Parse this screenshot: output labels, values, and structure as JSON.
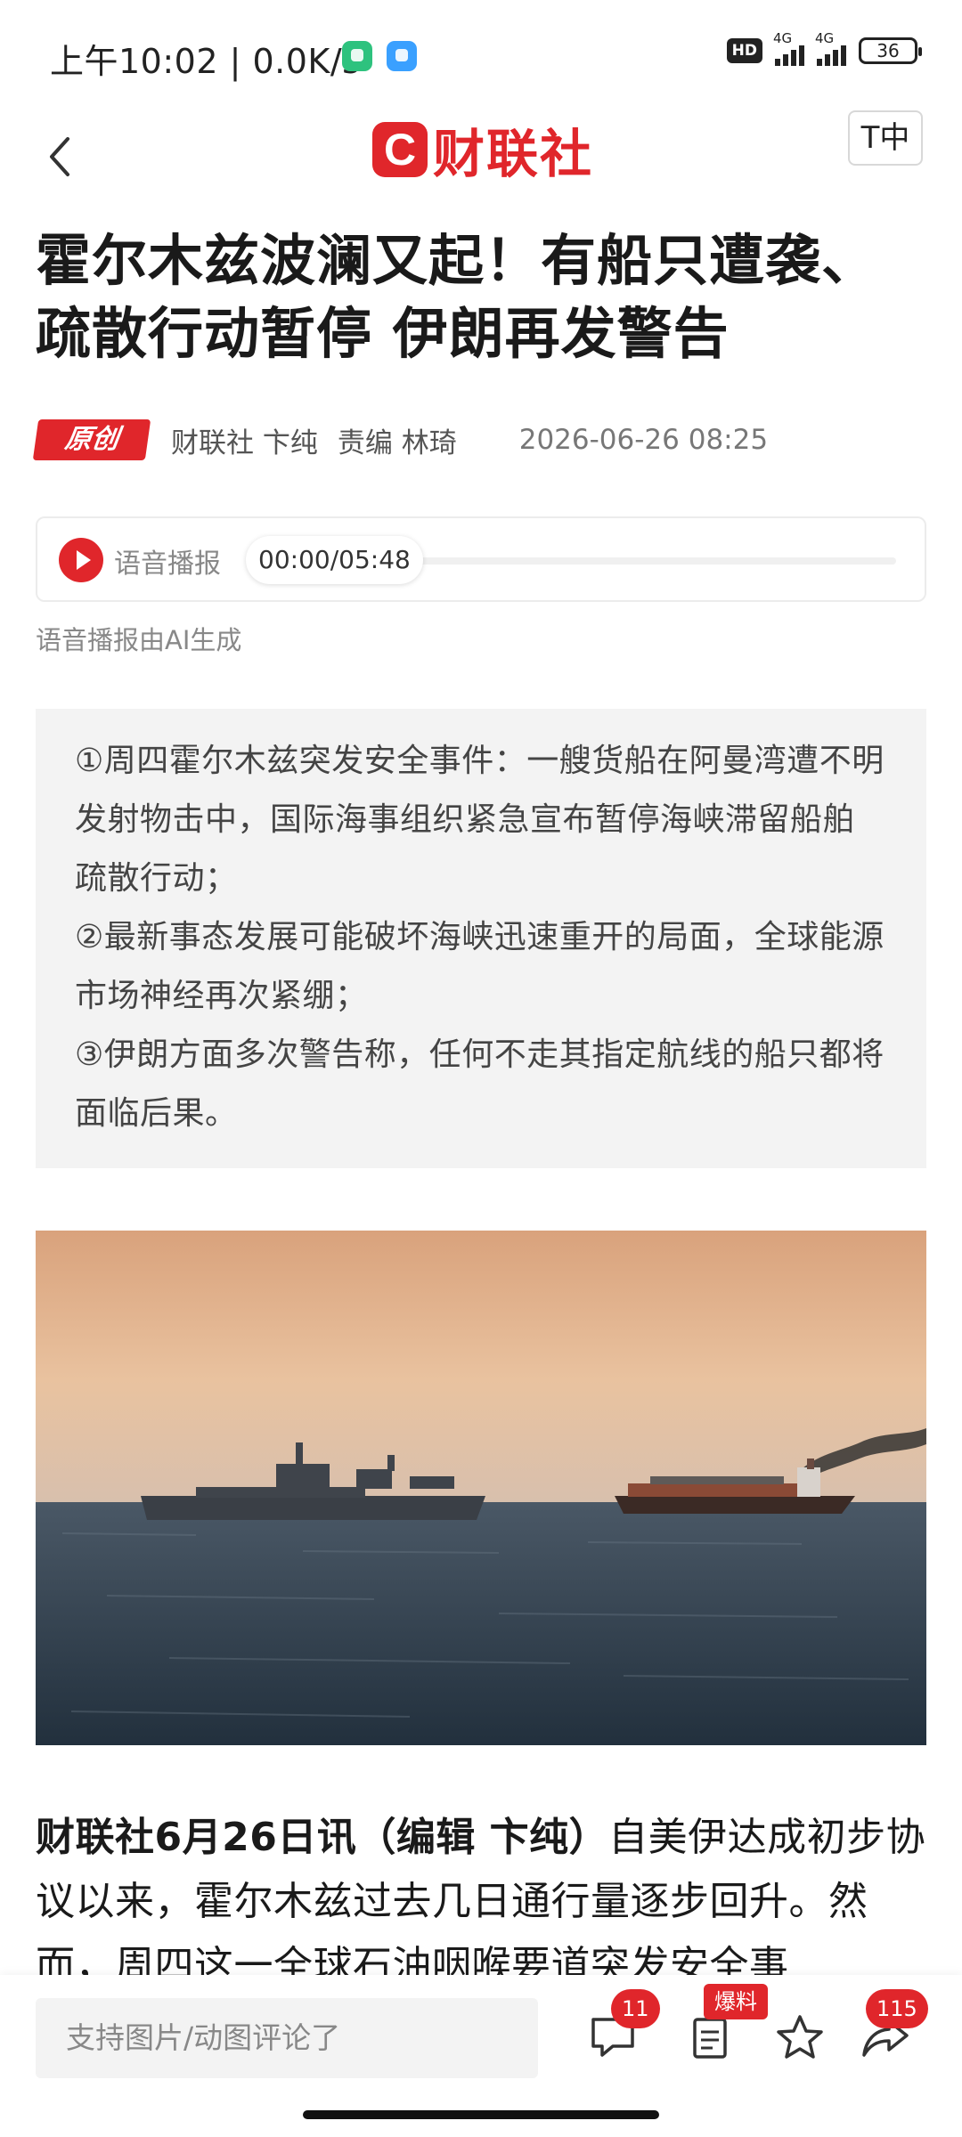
{
  "status_bar": {
    "time_speed": "上午10:02 | 0.0K/s",
    "hd": "HD",
    "network1": "4G",
    "network2": "4G",
    "battery": "36"
  },
  "nav": {
    "logo_mark": "C",
    "logo_text": "财联社",
    "font_size_button": "T中"
  },
  "article": {
    "title": "霍尔木兹波澜又起！有船只遭袭、疏散行动暂停 伊朗再发警告",
    "badge": "原创",
    "author": "财联社 卞纯",
    "editor": "责编 林琦",
    "date": "2026-06-26 08:25",
    "audio": {
      "label": "语音播报",
      "time": "00:00/05:48",
      "progress": 0,
      "note": "语音播报由AI生成"
    },
    "summary": [
      "①周四霍尔木兹突发安全事件：一艘货船在阿曼湾遭不明发射物击中，国际海事组织紧急宣布暂停海峡滞留船舶疏散行动；",
      "②最新事态发展可能破坏海峡迅速重开的局面，全球能源市场神经再次紧绷；",
      "③伊朗方面多次警告称，任何不走其指定航线的船只都将面临后果。"
    ],
    "body_lead": "财联社6月26日讯（编辑 卞纯）",
    "body_text": "自美伊达成初步协议以来，霍尔木兹过去几日通行量逐步回升。然而，周四这一全球石油咽喉要道突发安全事"
  },
  "bottom_bar": {
    "comment_placeholder": "支持图片/动图评论了",
    "comment_count": "11",
    "report_badge": "爆料",
    "share_count": "115"
  },
  "colors": {
    "brand_red": "#e0262b",
    "summary_bg": "#f3f3f3"
  }
}
